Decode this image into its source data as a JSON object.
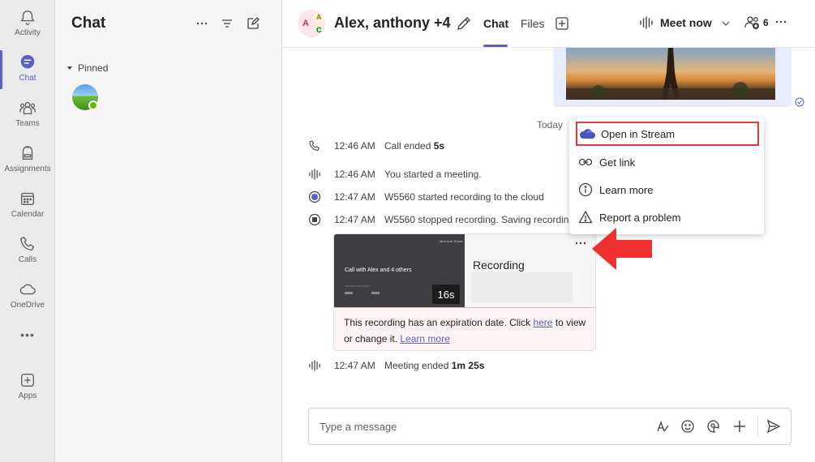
{
  "rail": {
    "items": [
      {
        "label": "Activity",
        "icon": "bell-icon"
      },
      {
        "label": "Chat",
        "icon": "chat-icon"
      },
      {
        "label": "Teams",
        "icon": "teams-icon"
      },
      {
        "label": "Assignments",
        "icon": "backpack-icon"
      },
      {
        "label": "Calendar",
        "icon": "calendar-icon"
      },
      {
        "label": "Calls",
        "icon": "phone-icon"
      },
      {
        "label": "OneDrive",
        "icon": "cloud-icon"
      },
      {
        "label": "Apps",
        "icon": "add-app-icon"
      }
    ],
    "more": "•••",
    "accent": "#5b5fc7"
  },
  "chatlist": {
    "title": "Chat",
    "pinned_label": "Pinned"
  },
  "header": {
    "title": "Alex, anthony +4",
    "avatar_letters": [
      "A",
      "A",
      "C"
    ],
    "tabs": [
      "Chat",
      "Files"
    ],
    "meet_label": "Meet now",
    "people_count": "6"
  },
  "messages": {
    "today_label": "Today",
    "events": [
      {
        "icon": "phone-icon",
        "time": "12:46 AM",
        "text": "Call ended ",
        "bold": "5s"
      },
      {
        "icon": "meeting-icon",
        "time": "12:46 AM",
        "text": "You started a meeting.",
        "bold": ""
      },
      {
        "icon": "record-icon",
        "time": "12:47 AM",
        "text": "W5560 started recording to the cloud",
        "bold": ""
      },
      {
        "icon": "stop-icon",
        "time": "12:47 AM",
        "text": "W5560 stopped recording. Saving recording",
        "bold": ""
      },
      {
        "icon": "meeting-icon",
        "time": "12:47 AM",
        "text": "Meeting ended ",
        "bold": "1m 25s"
      }
    ]
  },
  "recording": {
    "thumb_brand": "Microsoft Teams",
    "thumb_title": "Call with Alex and 4 others",
    "thumb_meta": "2024-08-19 07:47 UTC",
    "duration": "16s",
    "title": "Recording",
    "expiry_text_1": "This recording has an expiration date. Click ",
    "expiry_link_here": "here",
    "expiry_text_2": " to view or change it. ",
    "expiry_link_learn": "Learn more"
  },
  "context_menu": {
    "items": [
      {
        "label": "Open in Stream",
        "icon": "stream-icon"
      },
      {
        "label": "Get link",
        "icon": "link-icon"
      },
      {
        "label": "Learn more",
        "icon": "info-icon"
      },
      {
        "label": "Report a problem",
        "icon": "warning-icon"
      }
    ],
    "highlight_color": "#e03a3a"
  },
  "compose": {
    "placeholder": "Type a message"
  }
}
